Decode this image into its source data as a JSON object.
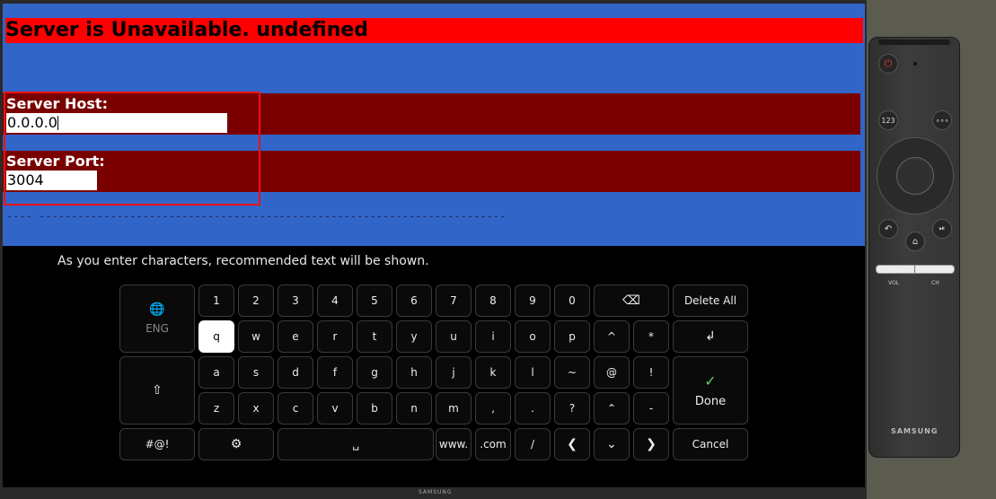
{
  "error": {
    "message": "Server is Unavailable. undefined"
  },
  "form": {
    "host": {
      "label": "Server Host:",
      "value": "0.0.0.0"
    },
    "port": {
      "label": "Server Port:",
      "value": "3004"
    },
    "dashes": "---- ------------------------------------------------------------------------"
  },
  "keyboard": {
    "hint": "As you enter characters, recommended text will be shown.",
    "language": "ENG",
    "rows": [
      [
        "1",
        "2",
        "3",
        "4",
        "5",
        "6",
        "7",
        "8",
        "9",
        "0"
      ],
      [
        "q",
        "w",
        "e",
        "r",
        "t",
        "y",
        "u",
        "i",
        "o",
        "p",
        "^",
        "*"
      ],
      [
        "a",
        "s",
        "d",
        "f",
        "g",
        "h",
        "j",
        "k",
        "l",
        "~",
        "@",
        "!"
      ],
      [
        "z",
        "x",
        "c",
        "v",
        "b",
        "n",
        "m",
        ",",
        ".",
        "?",
        "⌃",
        "-"
      ]
    ],
    "delete_all_label": "Delete All",
    "done_label": "Done",
    "symbols_label": "#@!",
    "www_label": "www.",
    "com_label": ".com",
    "slash_label": "/",
    "cancel_label": "Cancel",
    "selected_key": "q"
  },
  "tv": {
    "brand": "SAMSUNG"
  },
  "remote": {
    "brand": "SAMSUNG",
    "num_label": "123",
    "vol_label": "VOL",
    "ch_label": "CH"
  },
  "colors": {
    "screen_bg": "#3265c8",
    "error_bg": "#ff0000",
    "field_bg": "#7a0000",
    "focus_border": "#ee1111",
    "keyboard_bg": "#000000"
  }
}
